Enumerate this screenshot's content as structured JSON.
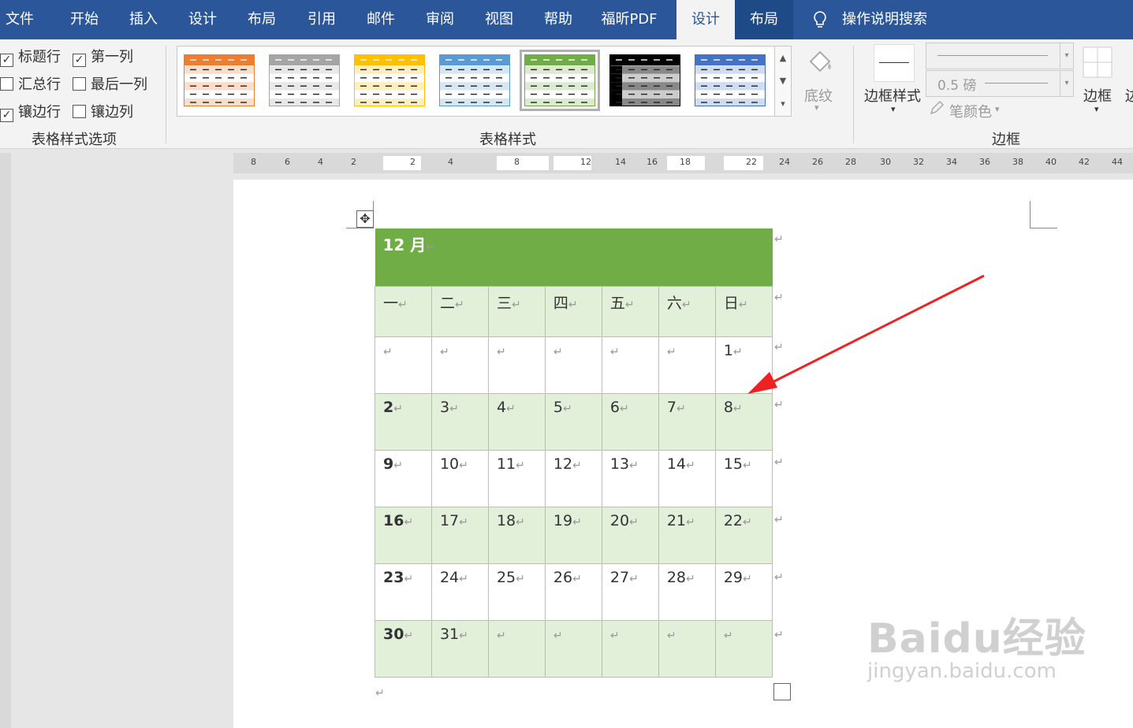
{
  "tabs": [
    "文件",
    "开始",
    "插入",
    "设计",
    "布局",
    "引用",
    "邮件",
    "审阅",
    "视图",
    "帮助",
    "福昕PDF",
    "设计",
    "布局"
  ],
  "active_tab_index": 11,
  "tell_me": "操作说明搜索",
  "style_options": {
    "items": [
      {
        "label": "标题行",
        "checked": true
      },
      {
        "label": "第一列",
        "checked": true
      },
      {
        "label": "汇总行",
        "checked": false
      },
      {
        "label": "最后一列",
        "checked": false
      },
      {
        "label": "镶边行",
        "checked": true
      },
      {
        "label": "镶边列",
        "checked": false
      }
    ],
    "group_label": "表格样式选项"
  },
  "table_styles": {
    "group_label": "表格样式",
    "thumb_colors": [
      "#ed7d31",
      "#a5a5a5",
      "#ffc000",
      "#5b9bd5",
      "#70ad47",
      "#000000",
      "#4472c4"
    ],
    "selected_index": 4
  },
  "shading_label": "底纹",
  "borders": {
    "style_label": "边框样式",
    "weight": "0.5 磅",
    "pen_color_label": "笔颜色",
    "borders_label": "边框",
    "group_label": "边框"
  },
  "ruler_labels": [
    "8",
    "6",
    "4",
    "2",
    "2",
    "4",
    "8",
    "12",
    "14",
    "16",
    "18",
    "22",
    "24",
    "26",
    "28",
    "30",
    "32",
    "34",
    "36",
    "38",
    "40",
    "42",
    "44"
  ],
  "calendar": {
    "title": "12 月",
    "weekdays": [
      "一",
      "二",
      "三",
      "四",
      "五",
      "六",
      "日"
    ],
    "weeks": [
      [
        "",
        "",
        "",
        "",
        "",
        "",
        "1"
      ],
      [
        "2",
        "3",
        "4",
        "5",
        "6",
        "7",
        "8"
      ],
      [
        "9",
        "10",
        "11",
        "12",
        "13",
        "14",
        "15"
      ],
      [
        "16",
        "17",
        "18",
        "19",
        "20",
        "21",
        "22"
      ],
      [
        "23",
        "24",
        "25",
        "26",
        "27",
        "28",
        "29"
      ],
      [
        "30",
        "31",
        "",
        "",
        "",
        "",
        ""
      ]
    ],
    "header_color": "#70ad47",
    "band_color": "#e2efd9",
    "border_color": "#a8d08d"
  },
  "paragraph_mark": "↵",
  "watermark": {
    "brand": "Baidu经验",
    "url": "jingyan.baidu.com"
  },
  "annotation_color": "#ee2222"
}
